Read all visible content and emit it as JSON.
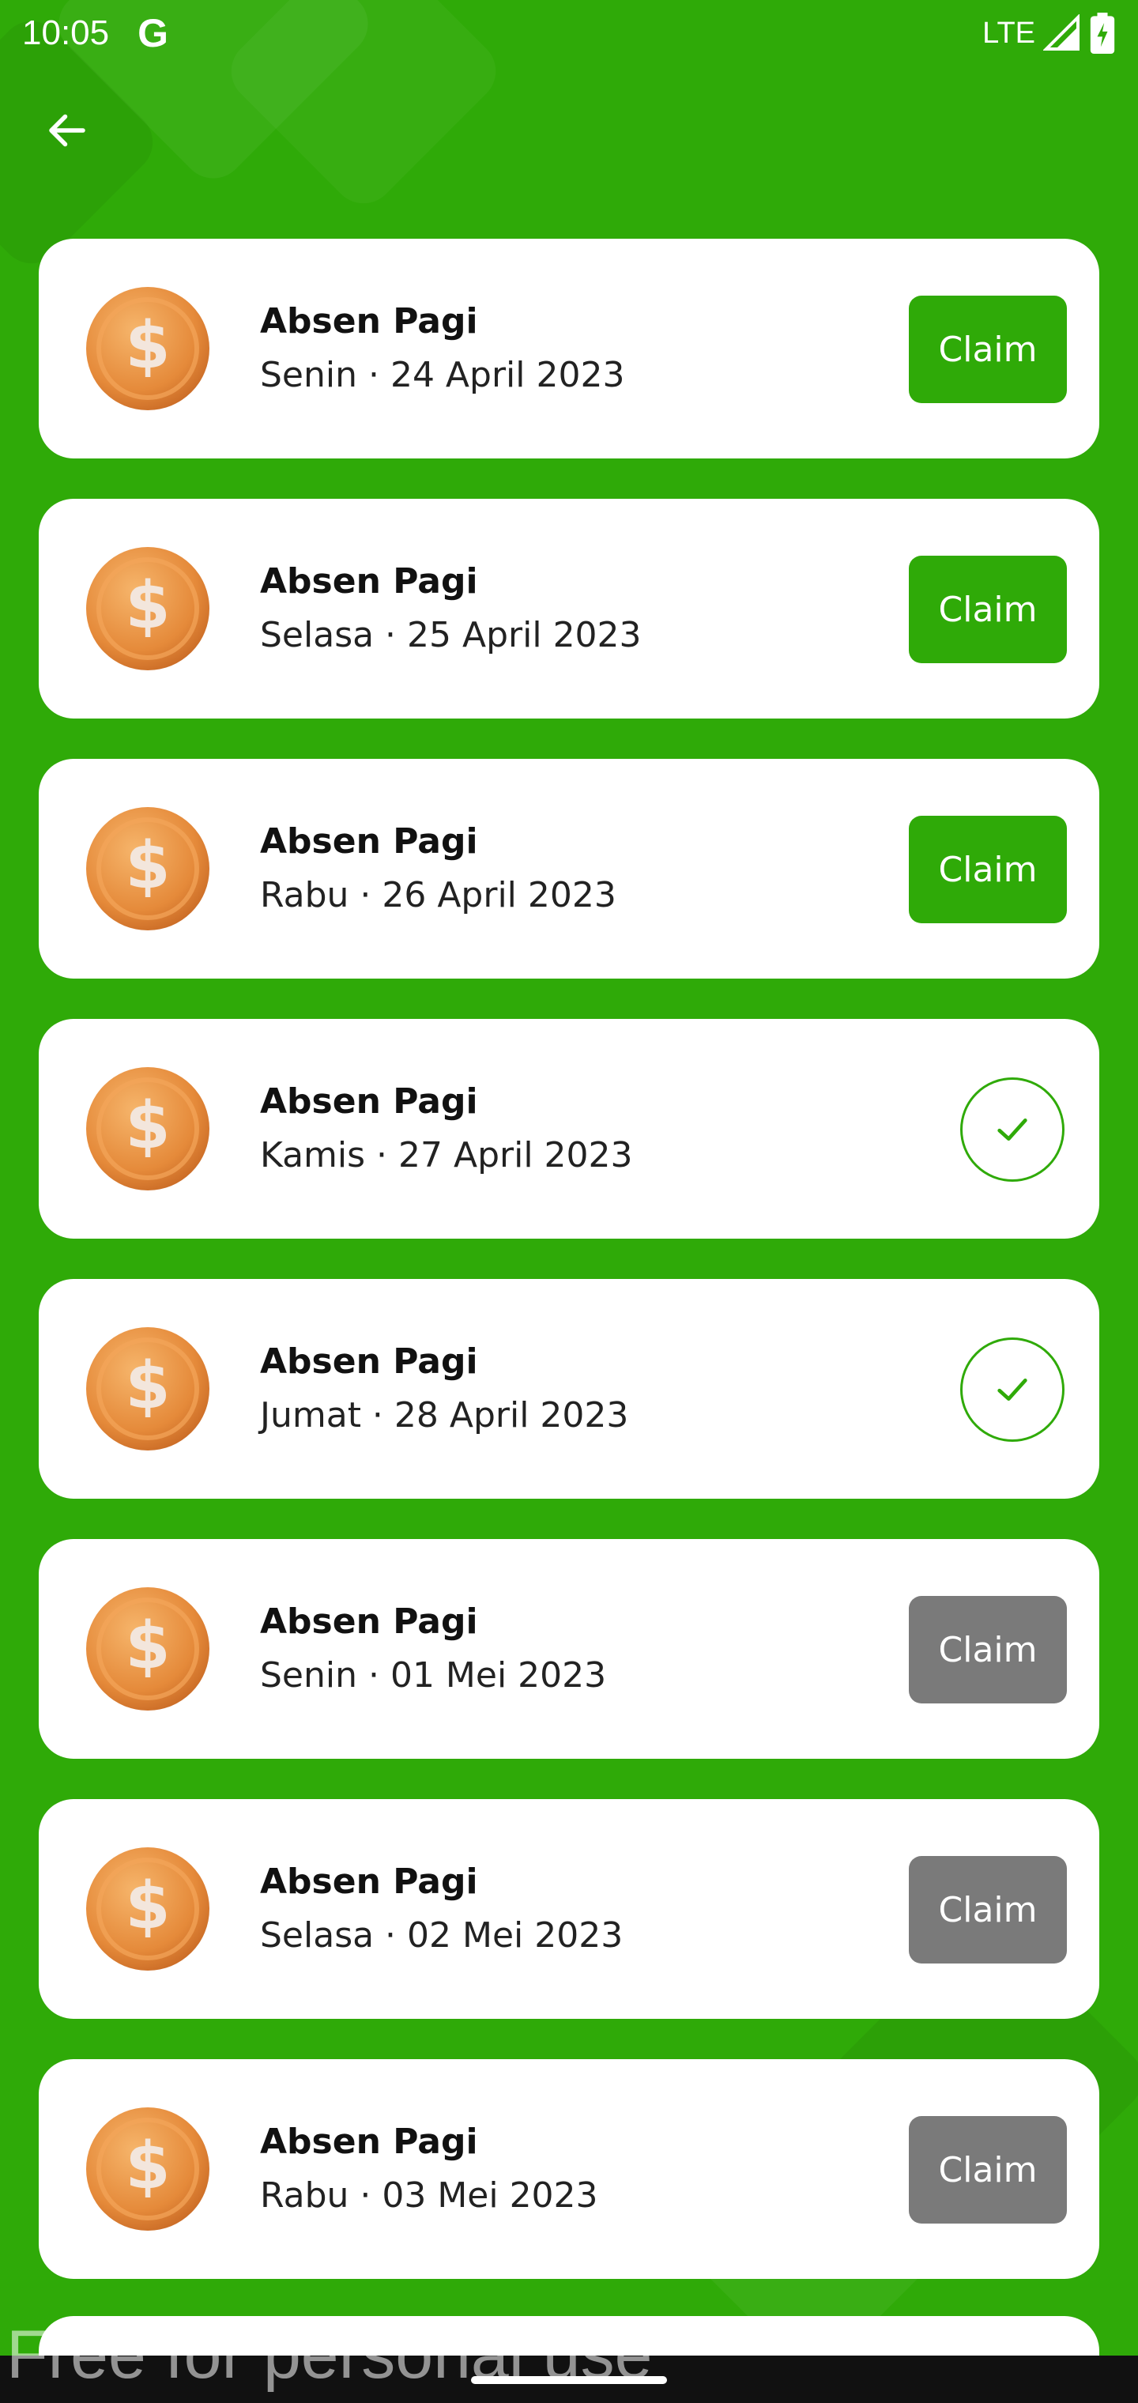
{
  "status_bar": {
    "time": "10:05",
    "g_label": "G",
    "network": "LTE"
  },
  "colors": {
    "background": "#2faa08",
    "claim_active": "#2faa08",
    "claim_disabled": "#7a7a7a",
    "card": "#ffffff"
  },
  "list": [
    {
      "title": "Absen Pagi",
      "subtitle": "Senin · 24 April 2023",
      "state": "claim",
      "label": "Claim"
    },
    {
      "title": "Absen Pagi",
      "subtitle": "Selasa · 25 April 2023",
      "state": "claim",
      "label": "Claim"
    },
    {
      "title": "Absen Pagi",
      "subtitle": "Rabu · 26 April 2023",
      "state": "claim",
      "label": "Claim"
    },
    {
      "title": "Absen Pagi",
      "subtitle": "Kamis · 27 April 2023",
      "state": "claimed",
      "label": ""
    },
    {
      "title": "Absen Pagi",
      "subtitle": "Jumat · 28 April 2023",
      "state": "claimed",
      "label": ""
    },
    {
      "title": "Absen Pagi",
      "subtitle": "Senin · 01 Mei 2023",
      "state": "disabled",
      "label": "Claim"
    },
    {
      "title": "Absen Pagi",
      "subtitle": "Selasa · 02 Mei 2023",
      "state": "disabled",
      "label": "Claim"
    },
    {
      "title": "Absen Pagi",
      "subtitle": "Rabu · 03 Mei 2023",
      "state": "disabled",
      "label": "Claim"
    }
  ],
  "watermark": "Free for personal use"
}
